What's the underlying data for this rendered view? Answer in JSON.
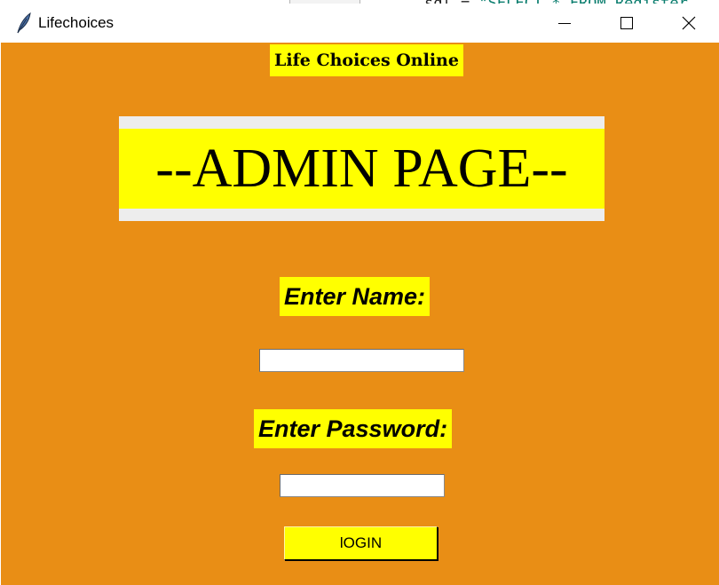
{
  "window": {
    "title": "Lifechoices",
    "icon": "feather-icon",
    "controls": {
      "minimize": "minimize-icon",
      "maximize": "maximize-icon",
      "close": "close-icon"
    }
  },
  "background_code": {
    "prefix": "sql = ",
    "string": "\"SELECT * FROM Register"
  },
  "page": {
    "brand": "Life Choices Online",
    "heading": "--ADMIN PAGE--",
    "name_label": "Enter Name:",
    "name_value": "",
    "password_label": "Enter Password:",
    "password_value": "",
    "login_label": "lOGIN"
  },
  "colors": {
    "background": "#E98E15",
    "highlight": "#FFFF00",
    "admin_border": "#EDEDED"
  }
}
